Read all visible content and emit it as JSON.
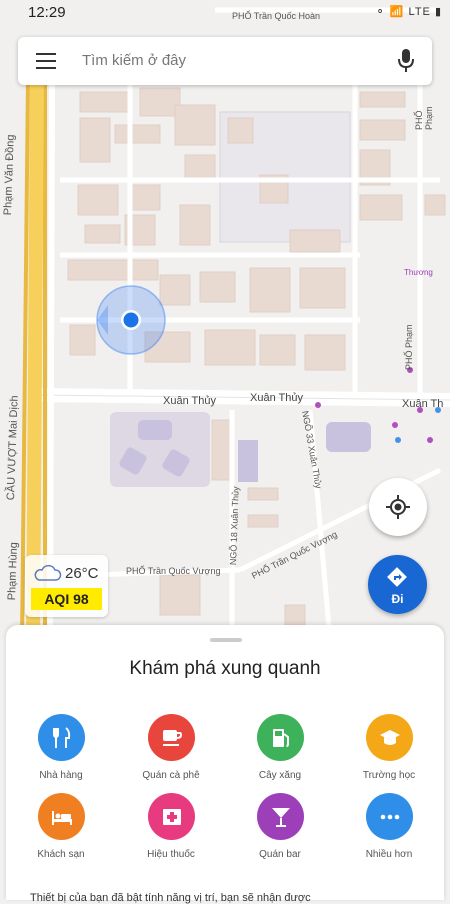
{
  "status_bar": {
    "time": "12:29",
    "icons": "⚬ 📶 LTE ▮"
  },
  "search": {
    "placeholder": "Tìm kiếm ở đây"
  },
  "map": {
    "labels": {
      "road_pham_van_dong": "Phạm Văn Đồng",
      "road_cau_vuot": "CẦU VƯỢT Mai Dịch",
      "road_xuan_thuy_1": "Xuân Thủy",
      "road_xuan_thuy_2": "Xuân Thủy",
      "road_xuan_thuy_3": "Xuân Th",
      "road_tran_quoc_hoan": "PHỐ Trần Quốc Hoàn",
      "road_tran_quoc_vuong_1": "PHỐ Trần Quốc Vượng",
      "road_tran_quoc_vuong_2": "PHỐ Trần Quốc Vượng",
      "road_ngo_18": "NGÕ 18 Xuân Thủy",
      "road_ngo_33": "NGÕ 33 Xuân Thủy",
      "road_pham_hung": "Phạm Hùng",
      "road_pho_pham": "PHỐ Phạm",
      "road_pho_pham_2": "PHỐ Phạm",
      "place_thuong": "Thương"
    }
  },
  "weather": {
    "temp": "26°C",
    "aqi": "AQI 98"
  },
  "directions": {
    "label": "Đi"
  },
  "explore": {
    "title": "Khám phá xung quanh",
    "categories": [
      {
        "label": "Nhà hàng",
        "icon": "restaurant-icon",
        "color": "#2e8ee8"
      },
      {
        "label": "Quán cà phê",
        "icon": "coffee-icon",
        "color": "#e8453c"
      },
      {
        "label": "Cây xăng",
        "icon": "gas-station-icon",
        "color": "#3db25b"
      },
      {
        "label": "Trường học",
        "icon": "school-icon",
        "color": "#f4a818"
      },
      {
        "label": "Khách sạn",
        "icon": "hotel-icon",
        "color": "#f07f22"
      },
      {
        "label": "Hiệu thuốc",
        "icon": "pharmacy-icon",
        "color": "#e83a7f"
      },
      {
        "label": "Quán bar",
        "icon": "bar-icon",
        "color": "#9c3fb8"
      },
      {
        "label": "Nhiều hơn",
        "icon": "more-icon",
        "color": "#2e8ee8"
      }
    ]
  },
  "bottom_text": "Thiết bị của bạn đã bật tính năng vị trí, bạn sẽ nhận được"
}
